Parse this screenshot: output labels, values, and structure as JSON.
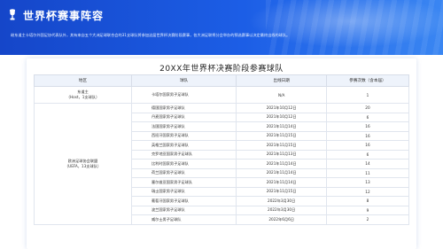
{
  "header": {
    "title": "世界杯赛事阵容",
    "intro": "继东道主卡塔尔外国足协代表队外，其有来自五个大洲足球联合会的31支球队将参加这届世界杯决赛阶段赛事，各大洲足联将分会举办的预选赛事以决定最终出线的球队。",
    "accent_color": "#1c5ee6"
  },
  "table": {
    "title": "20XX年世界杯决赛阶段参赛球队",
    "columns": [
      "地区",
      "球队",
      "出线日期",
      "参赛次数（含本届）"
    ],
    "host_region": "东道主\n（Host，1支球队）",
    "uefa_region": "欧洲足球协会联盟\n（UEFA，13支球队）",
    "rows": [
      {
        "team": "卡塔尔国家男子足球队",
        "date": "N/A",
        "count": "1"
      },
      {
        "team": "德国国家男子足球队",
        "date": "2021年10月12日",
        "count": "20"
      },
      {
        "team": "丹麦国家男子足球队",
        "date": "2021年10月12日",
        "count": "6"
      },
      {
        "team": "法国国家男子足球队",
        "date": "2021年11月14日",
        "count": "16"
      },
      {
        "team": "西班牙国家男子足球队",
        "date": "2021年11月15日",
        "count": "16"
      },
      {
        "team": "英格兰国家男子足球队",
        "date": "2021年11月15日",
        "count": "16"
      },
      {
        "team": "克罗地亚国家男子足球队",
        "date": "2021年11月13日",
        "count": "6"
      },
      {
        "team": "比利时国家男子足球队",
        "date": "2021年11月14日",
        "count": "14"
      },
      {
        "team": "荷兰国家男子足球队",
        "date": "2021年11月14日",
        "count": "11"
      },
      {
        "team": "塞尔维亚国家男子足球队",
        "date": "2021年11月14日",
        "count": "13"
      },
      {
        "team": "瑞士国家男子足球队",
        "date": "2021年11月15日",
        "count": "12"
      },
      {
        "team": "葡萄牙国家男子足球队",
        "date": "2022年3月30日",
        "count": "8"
      },
      {
        "team": "波兰国家男子足球队",
        "date": "2022年3月30日",
        "count": "9"
      },
      {
        "team": "威尔士男子足球队",
        "date": "2022年6月6日",
        "count": "2"
      }
    ]
  }
}
